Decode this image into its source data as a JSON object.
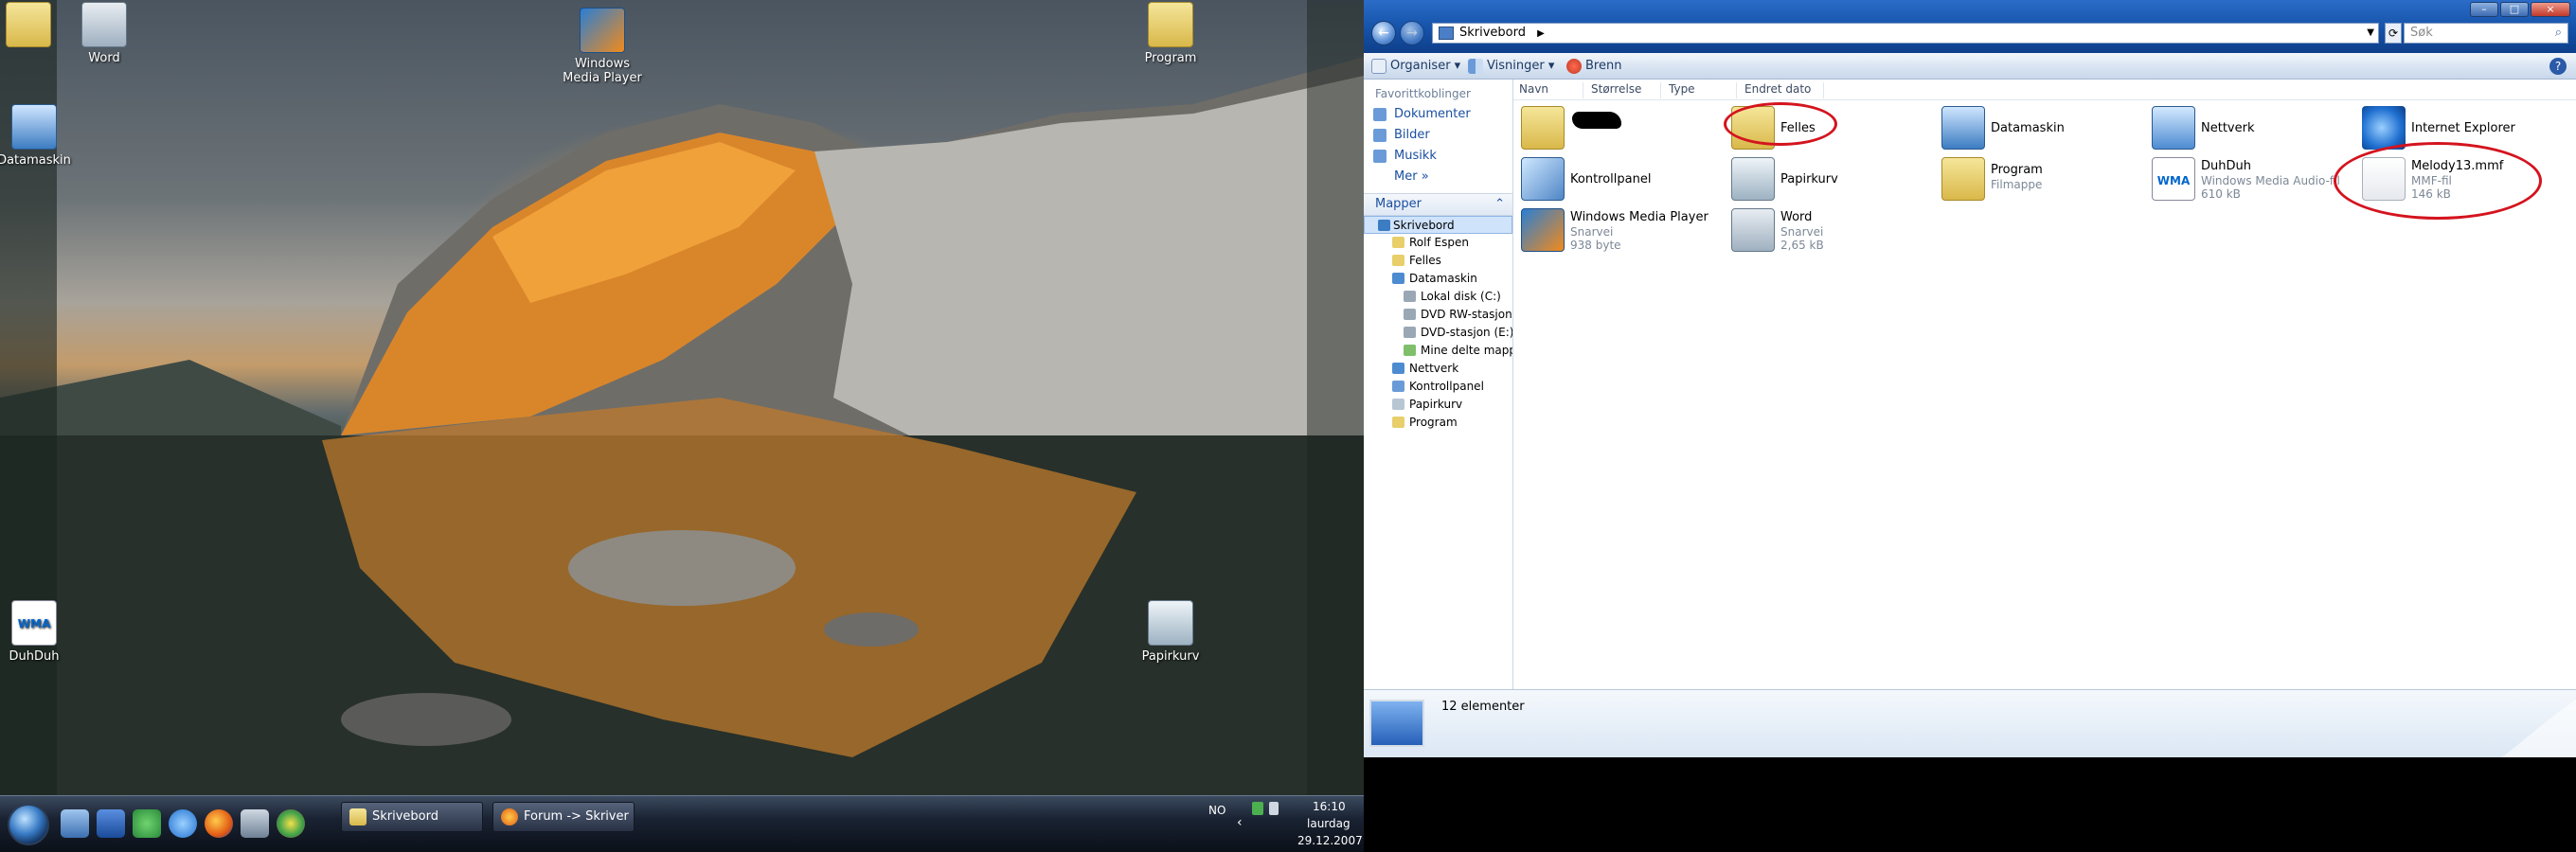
{
  "desktop": {
    "icons": [
      {
        "label": "",
        "icon": "folder-icon"
      },
      {
        "label": "Word",
        "icon": "word-shortcut-icon"
      },
      {
        "label": "Windows Media Player",
        "icon": "media-player-icon"
      },
      {
        "label": "Program",
        "icon": "folder-icon"
      },
      {
        "label": "Datamaskin",
        "icon": "computer-icon"
      },
      {
        "label": "DuhDuh",
        "icon": "wma-file-icon"
      },
      {
        "label": "Papirkurv",
        "icon": "recycle-bin-icon"
      }
    ],
    "wma_badge": "WMA"
  },
  "taskbar": {
    "buttons": [
      {
        "label": "Skrivebord",
        "icon": "explorer-icon"
      },
      {
        "label": "Forum -> Skriver ny...",
        "icon": "firefox-icon"
      }
    ],
    "tray": {
      "language": "NO",
      "time": "16:10",
      "day": "laurdag",
      "date": "29.12.2007"
    }
  },
  "explorer": {
    "address": "Skrivebord",
    "search_placeholder": "Søk",
    "toolbar": {
      "organize": "Organiser",
      "views": "Visninger",
      "burn": "Brenn"
    },
    "nav": {
      "favorites_header": "Favorittkoblinger",
      "favorites": [
        "Dokumenter",
        "Bilder",
        "Musikk",
        "Mer"
      ],
      "folders_header": "Mapper",
      "tree": [
        "Skrivebord",
        "Rolf Espen",
        "Felles",
        "Datamaskin",
        "Lokal disk (C:)",
        "DVD RW-stasjon (",
        "DVD-stasjon (E:)",
        "Mine delte mappe",
        "Nettverk",
        "Kontrollpanel",
        "Papirkurv",
        "Program"
      ]
    },
    "columns": [
      "Navn",
      "Størrelse",
      "Type",
      "Endret dato"
    ],
    "items": [
      {
        "name": "",
        "sub1": "",
        "sub2": "",
        "icon": "folder-icon"
      },
      {
        "name": "Felles",
        "sub1": "",
        "sub2": "",
        "icon": "folder-icon"
      },
      {
        "name": "Datamaskin",
        "sub1": "",
        "sub2": "",
        "icon": "computer-icon"
      },
      {
        "name": "Nettverk",
        "sub1": "",
        "sub2": "",
        "icon": "network-icon"
      },
      {
        "name": "Internet Explorer",
        "sub1": "",
        "sub2": "",
        "icon": "internet-explorer-icon"
      },
      {
        "name": "Kontrollpanel",
        "sub1": "",
        "sub2": "",
        "icon": "control-panel-icon"
      },
      {
        "name": "Papirkurv",
        "sub1": "",
        "sub2": "",
        "icon": "recycle-bin-icon"
      },
      {
        "name": "Program",
        "sub1": "Filmappe",
        "sub2": "",
        "icon": "folder-icon"
      },
      {
        "name": "DuhDuh",
        "sub1": "Windows Media Audio-fil",
        "sub2": "610 kB",
        "icon": "wma-file-icon"
      },
      {
        "name": "Melody13.mmf",
        "sub1": "MMF-fil",
        "sub2": "146 kB",
        "icon": "generic-file-icon"
      },
      {
        "name": "Windows Media Player",
        "sub1": "Snarvei",
        "sub2": "938 byte",
        "icon": "media-player-icon"
      },
      {
        "name": "Word",
        "sub1": "Snarvei",
        "sub2": "2,65 kB",
        "icon": "word-shortcut-icon"
      }
    ],
    "status": "12 elementer"
  }
}
